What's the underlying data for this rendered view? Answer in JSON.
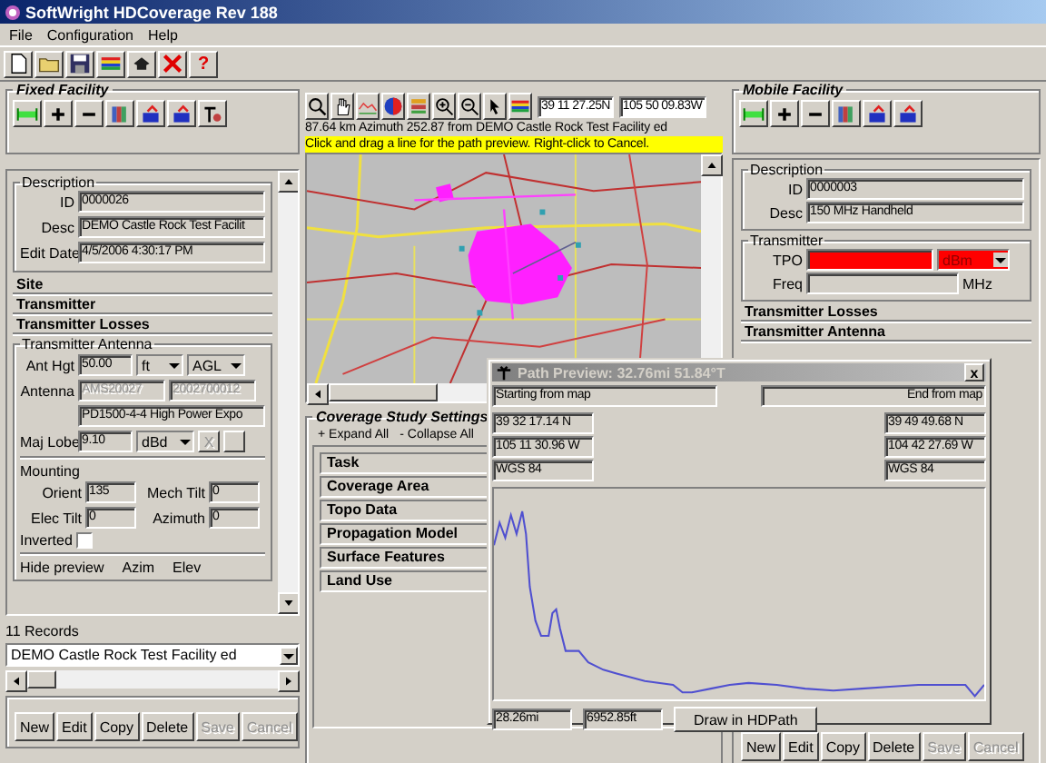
{
  "window": {
    "title": "SoftWright HDCoverage Rev 188"
  },
  "menu": [
    {
      "label": "File"
    },
    {
      "label": "Configuration"
    },
    {
      "label": "Help"
    }
  ],
  "toolbar": {
    "help": "?"
  },
  "fixed_facility": {
    "title": "Fixed Facility",
    "description": {
      "title": "Description",
      "fields": [
        {
          "label": "ID",
          "value": "0000026"
        },
        {
          "label": "Desc",
          "value": "DEMO Castle Rock Test Facilit"
        },
        {
          "label": "Edit Date",
          "value": "4/5/2006 4:30:17 PM"
        }
      ]
    },
    "sections": [
      "Site",
      "Transmitter",
      "Transmitter Losses"
    ],
    "antenna": {
      "title": "Transmitter Antenna",
      "ant_hgt_label": "Ant Hgt",
      "ant_hgt": "50.00",
      "ant_hgt_unit": "ft",
      "ant_hgt_ref": "AGL",
      "antenna_label": "Antenna",
      "antenna_codes": [
        {
          "value": "AMS20027",
          "disabled": true
        },
        {
          "value": "2002700012",
          "disabled": true
        }
      ],
      "antenna_name": "PD1500-4-4 High Power Expo",
      "maj_lobe_label": "Maj Lobe",
      "maj_lobe": "9.10",
      "maj_lobe_unit": "dBd",
      "clear_button": "X",
      "mounting_title": "Mounting",
      "mounting": [
        {
          "label": "Orient",
          "value": "135"
        },
        {
          "label": "Mech Tilt",
          "value": "0"
        },
        {
          "label": "Elec Tilt",
          "value": "0"
        },
        {
          "label": "Azimuth",
          "value": "0"
        }
      ],
      "inverted": {
        "label": "Inverted",
        "checked": false
      },
      "preview_labels": [
        "Hide preview",
        "Azim",
        "Elev"
      ]
    },
    "records": "11 Records",
    "record": "DEMO Castle Rock Test Facility ed",
    "buttons": [
      {
        "label": "New",
        "disabled": false
      },
      {
        "label": "Edit",
        "disabled": false
      },
      {
        "label": "Copy",
        "disabled": false
      },
      {
        "label": "Delete",
        "disabled": false
      },
      {
        "label": "Save",
        "disabled": true
      },
      {
        "label": "Cancel",
        "disabled": true
      }
    ]
  },
  "map": {
    "coords": [
      "39 11 27.25N",
      "105 50 09.83W"
    ],
    "status": "87.64 km Azimuth 252.87 from DEMO Castle Rock Test Facility ed",
    "hint": "Click and drag a line for the path preview.  Right-click to Cancel."
  },
  "coverage_settings": {
    "title": "Coverage Study Settings",
    "expand": "+ Expand All",
    "collapse": "- Collapse All",
    "sections": [
      "Task",
      "Coverage Area",
      "Topo Data",
      "Propagation Model",
      "Surface Features",
      "Land Use"
    ]
  },
  "mobile_facility": {
    "title": "Mobile Facility",
    "description": {
      "title": "Description",
      "fields": [
        {
          "label": "ID",
          "value": "0000003"
        },
        {
          "label": "Desc",
          "value": "150 MHz Handheld"
        }
      ]
    },
    "transmitter": {
      "title": "Transmitter",
      "tpo_label": "TPO",
      "tpo_unit": "dBm",
      "invalid": true,
      "freq_label": "Freq",
      "freq_unit": "MHz"
    },
    "sections": [
      "Transmitter Losses",
      "Transmitter Antenna"
    ],
    "buttons": [
      {
        "label": "New",
        "disabled": false
      },
      {
        "label": "Edit",
        "disabled": false
      },
      {
        "label": "Copy",
        "disabled": false
      },
      {
        "label": "Delete",
        "disabled": false
      },
      {
        "label": "Save",
        "disabled": true
      },
      {
        "label": "Cancel",
        "disabled": true
      }
    ]
  },
  "path_preview": {
    "title": "Path Preview: 32.76mi 51.84°T",
    "active": false,
    "close": "x",
    "start": "Starting from map",
    "end": "End from map",
    "start_coords": [
      "39 32 17.14 N",
      "105 11 30.96 W",
      "WGS 84"
    ],
    "end_coords": [
      "39 49 49.68 N",
      "104 42 27.69 W",
      "WGS 84"
    ],
    "distance": "28.26mi",
    "elevation": "6952.85ft",
    "draw_button": "Draw in HDPath"
  }
}
